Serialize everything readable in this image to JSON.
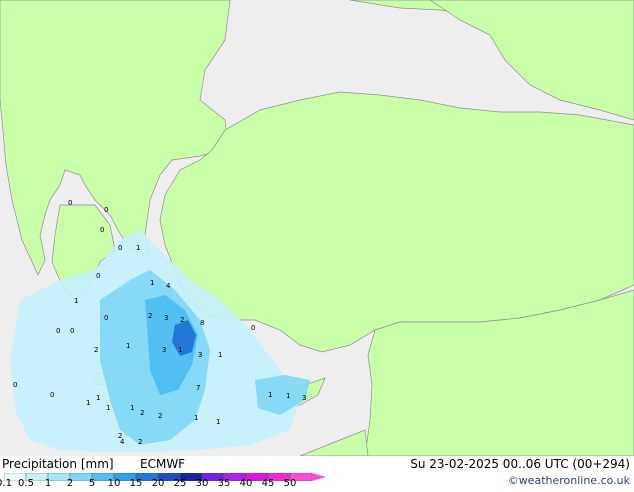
{
  "map": {
    "colors": {
      "sea": "#eeeeee",
      "land": "#c8ffa8",
      "border": "#909090"
    },
    "station_values": [
      "0",
      "0",
      "0",
      "0",
      "0",
      "1",
      "0",
      "1",
      "4",
      "1",
      "2",
      "3",
      "2",
      "8",
      "1",
      "3",
      "1",
      "0",
      "0",
      "1",
      "3",
      "1",
      "2",
      "2",
      "0",
      "0",
      "0",
      "1",
      "1",
      "2",
      "4",
      "2",
      "1",
      "1",
      "3",
      "2",
      "1",
      "7",
      "1",
      "1"
    ]
  },
  "legend": {
    "title": "Precipitation [mm]",
    "model": "ECMWF",
    "valid_time": "Su 23-02-2025 00..06 UTC (00+294)",
    "credit": "©weatheronline.co.uk",
    "scale": [
      {
        "label": "0.1",
        "color": "#e8fbff"
      },
      {
        "label": "0.5",
        "color": "#c4f1fc"
      },
      {
        "label": "1",
        "color": "#a4e6fb"
      },
      {
        "label": "2",
        "color": "#7fd6f7"
      },
      {
        "label": "5",
        "color": "#52bff2"
      },
      {
        "label": "10",
        "color": "#2f9fe8"
      },
      {
        "label": "15",
        "color": "#2176d6"
      },
      {
        "label": "20",
        "color": "#1c4fc0"
      },
      {
        "label": "25",
        "color": "#14239e"
      },
      {
        "label": "30",
        "color": "#7a1fe0"
      },
      {
        "label": "35",
        "color": "#b21ee6"
      },
      {
        "label": "40",
        "color": "#d81ae0"
      },
      {
        "label": "45",
        "color": "#ee2ad8"
      },
      {
        "label": "50",
        "color": "#f64fd6"
      }
    ]
  }
}
